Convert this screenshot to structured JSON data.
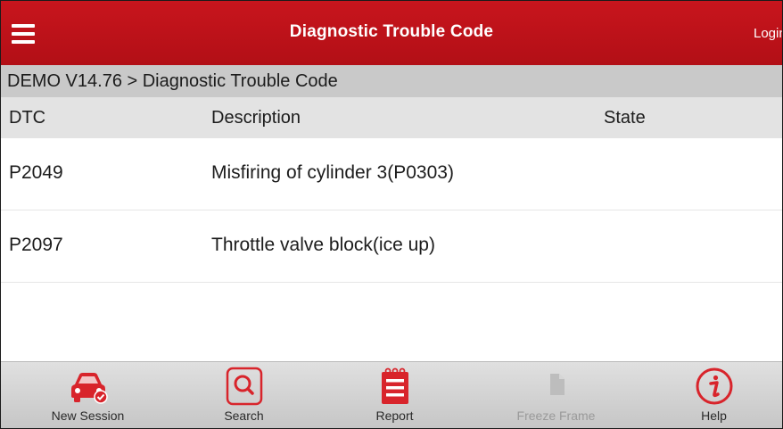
{
  "header": {
    "title": "Diagnostic Trouble Code",
    "login_label": "Login",
    "menu_icon": "hamburger-menu-icon",
    "accent_color": "#c0121a"
  },
  "breadcrumb": "DEMO V14.76 > Diagnostic Trouble Code",
  "table": {
    "columns": [
      "DTC",
      "Description",
      "State"
    ],
    "rows": [
      {
        "dtc": "P2049",
        "description": "Misfiring of cylinder 3(P0303)",
        "state": ""
      },
      {
        "dtc": "P2097",
        "description": "Throttle valve block(ice up)",
        "state": ""
      }
    ]
  },
  "bottom_nav": [
    {
      "label": "New Session",
      "icon": "car-icon",
      "enabled": true
    },
    {
      "label": "Search",
      "icon": "search-icon",
      "enabled": true
    },
    {
      "label": "Report",
      "icon": "report-icon",
      "enabled": true
    },
    {
      "label": "Freeze Frame",
      "icon": "freeze-frame-icon",
      "enabled": false
    },
    {
      "label": "Help",
      "icon": "help-icon",
      "enabled": true
    }
  ]
}
